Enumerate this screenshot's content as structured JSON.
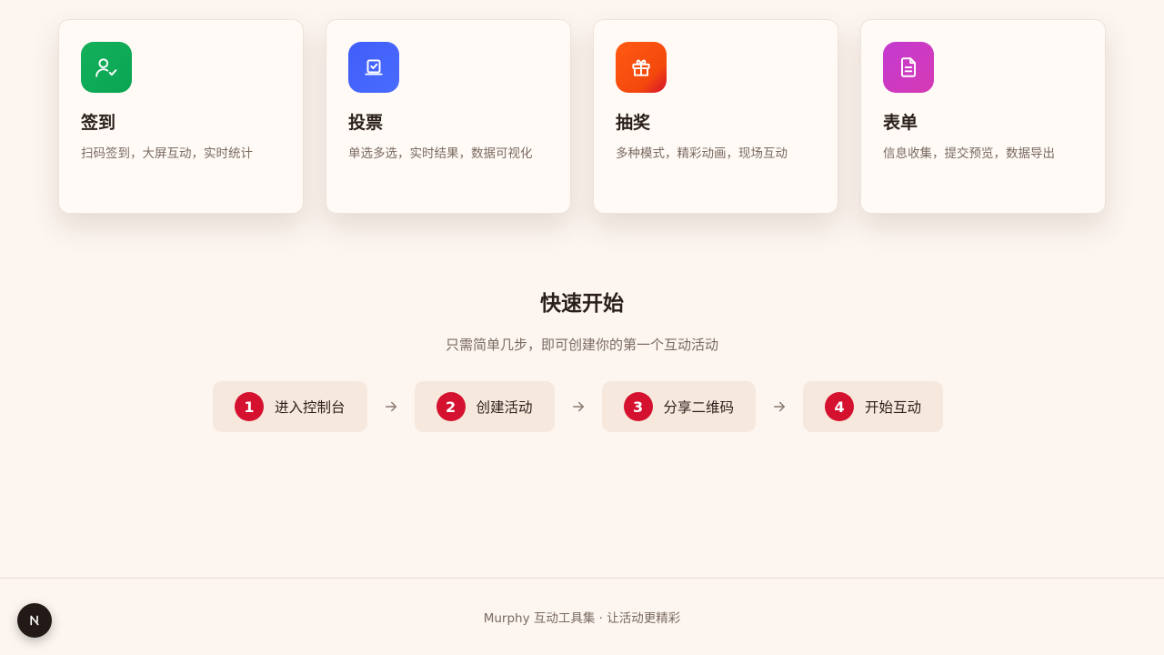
{
  "features": [
    {
      "title": "签到",
      "desc": "扫码签到，大屏互动，实时统计",
      "icon": "user-check-icon",
      "color": "#13b05c"
    },
    {
      "title": "投票",
      "desc": "单选多选，实时结果，数据可视化",
      "icon": "vote-box-icon",
      "color": "#3f5ef8"
    },
    {
      "title": "抽奖",
      "desc": "多种模式，精彩动画，现场互动",
      "icon": "gift-icon",
      "color": "#f4480d"
    },
    {
      "title": "表单",
      "desc": "信息收集，提交预览，数据导出",
      "icon": "document-icon",
      "color": "#c33bd0"
    }
  ],
  "quick_start": {
    "title": "快速开始",
    "subtitle": "只需简单几步，即可创建你的第一个互动活动",
    "steps": [
      {
        "num": "1",
        "label": "进入控制台"
      },
      {
        "num": "2",
        "label": "创建活动"
      },
      {
        "num": "3",
        "label": "分享二维码"
      },
      {
        "num": "4",
        "label": "开始互动"
      }
    ]
  },
  "footer": {
    "text": "Murphy 互动工具集 · 让活动更精彩"
  },
  "colors": {
    "accent": "#d4112e",
    "background": "#fcf5f0"
  }
}
